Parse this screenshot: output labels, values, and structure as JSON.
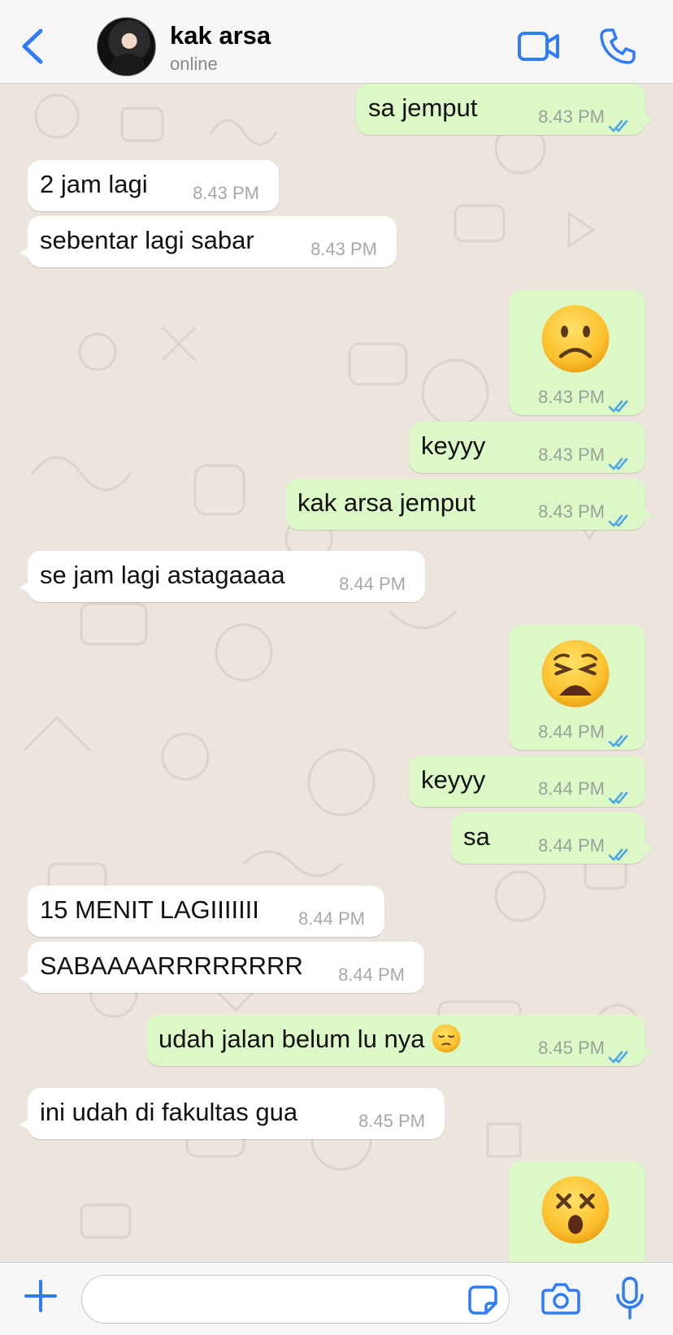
{
  "header": {
    "contact_name": "kak arsa",
    "status": "online",
    "back_icon": "chevron-left-icon",
    "video_icon": "video-camera-icon",
    "call_icon": "phone-icon"
  },
  "colors": {
    "accent": "#2f7cf6",
    "incoming_bubble": "#ffffff",
    "outgoing_bubble": "#dcf8c6",
    "read_ticks": "#4fa6e8"
  },
  "messages": [
    {
      "dir": "out",
      "text": "sa jemput",
      "time": "8.43 PM",
      "read": true
    },
    {
      "dir": "in",
      "text": "2 jam lagi",
      "time": "8.43 PM"
    },
    {
      "dir": "in",
      "text": "sebentar lagi sabar",
      "time": "8.43 PM"
    },
    {
      "dir": "out",
      "emoji": "frowning-face",
      "time": "8.43 PM",
      "read": true
    },
    {
      "dir": "out",
      "text": "keyyy",
      "time": "8.43 PM",
      "read": true
    },
    {
      "dir": "out",
      "text": "kak arsa jemput",
      "time": "8.43 PM",
      "read": true
    },
    {
      "dir": "in",
      "text": "se jam lagi astagaaaa",
      "time": "8.44 PM"
    },
    {
      "dir": "out",
      "emoji": "weary-face",
      "time": "8.44 PM",
      "read": true
    },
    {
      "dir": "out",
      "text": "keyyy",
      "time": "8.44 PM",
      "read": true
    },
    {
      "dir": "out",
      "text": "sa",
      "time": "8.44 PM",
      "read": true
    },
    {
      "dir": "in",
      "text": "15 MENIT LAGIIIIIII",
      "time": "8.44 PM"
    },
    {
      "dir": "in",
      "text": "SABAAAARRRRRRRR",
      "time": "8.44 PM"
    },
    {
      "dir": "out",
      "text": "udah jalan belum lu nya",
      "emoji_inline": "pensive-face",
      "time": "8.45 PM",
      "read": true
    },
    {
      "dir": "in",
      "text": "ini udah di fakultas gua",
      "time": "8.45 PM"
    },
    {
      "dir": "out",
      "emoji": "dizzy-face",
      "time": "",
      "read": true
    }
  ],
  "input": {
    "placeholder": "",
    "plus_icon": "plus-icon",
    "sticker_icon": "sticker-icon",
    "camera_icon": "camera-icon",
    "mic_icon": "microphone-icon"
  }
}
